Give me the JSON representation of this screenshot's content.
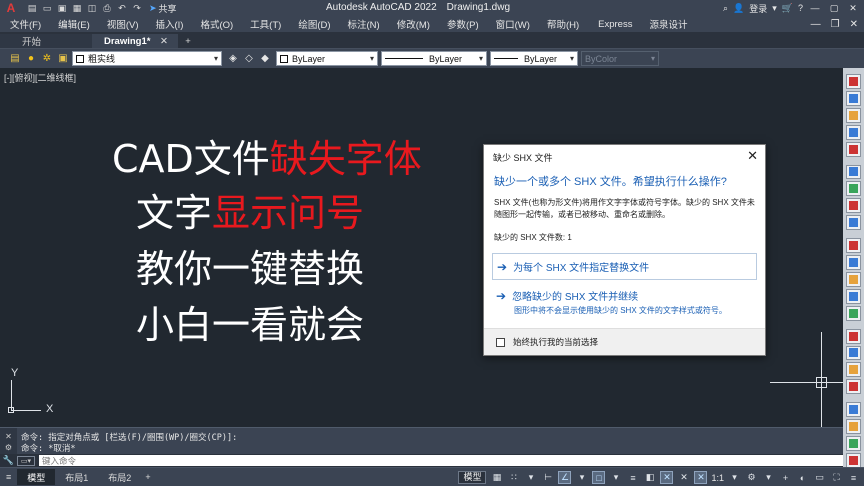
{
  "titlebar": {
    "logo": "A",
    "share_label": "共享",
    "app_name": "Autodesk AutoCAD 2022",
    "file_name": "Drawing1.dwg",
    "login_label": "登录"
  },
  "menubar": {
    "items": [
      "文件(F)",
      "编辑(E)",
      "视图(V)",
      "插入(I)",
      "格式(O)",
      "工具(T)",
      "绘图(D)",
      "标注(N)",
      "修改(M)",
      "参数(P)",
      "窗口(W)",
      "帮助(H)",
      "Express",
      "源泉设计"
    ]
  },
  "tabs": {
    "start": "开始",
    "active": "Drawing1*",
    "plus": "+"
  },
  "properties": {
    "layer": "粗实线",
    "color": "ByLayer",
    "linetype": "ByLayer",
    "lineweight": "ByLayer",
    "plotstyle": "ByColor"
  },
  "viewport": {
    "label": "[-][俯视][二维线框]"
  },
  "overlay": {
    "line1_white": "CAD文件",
    "line1_red": "缺失字体",
    "line2_white": "文字",
    "line2_red": "显示问号",
    "line3": "教你一键替换",
    "line4": "小白一看就会"
  },
  "dialog": {
    "title": "缺少 SHX 文件",
    "heading": "缺少一个或多个 SHX 文件。希望执行什么操作?",
    "description": "SHX 文件(也称为形文件)将用作文字字体或符号字体。缺少的 SHX 文件未随图形一起传输，或者已被移动、重命名或删除。",
    "count": "缺少的 SHX 文件数: 1",
    "option1": "为每个 SHX 文件指定替换文件",
    "option2": "忽略缺少的 SHX 文件并继续",
    "option2_sub": "图形中将不会显示使用缺少的 SHX 文件的文字样式或符号。",
    "checkbox": "始终执行我的当前选择"
  },
  "ucs": {
    "x": "X",
    "y": "Y"
  },
  "command": {
    "line1": "命令: 指定对角点或 [栏选(F)/圈围(WP)/圈交(CP)]:",
    "line2": "命令: *取消*",
    "placeholder": "键入命令"
  },
  "status": {
    "tabs": [
      "模型",
      "布局1",
      "布局2"
    ],
    "model_button": "模型",
    "scale": "1:1"
  }
}
